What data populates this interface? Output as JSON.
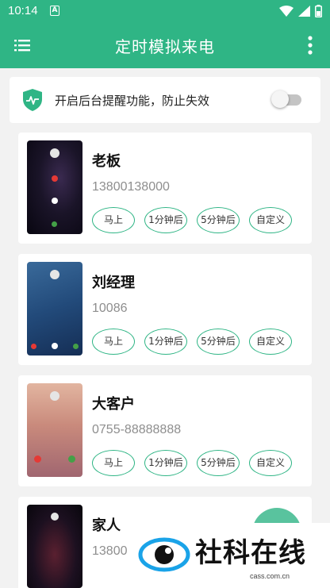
{
  "status_bar": {
    "time": "10:14",
    "notification_icon": "A"
  },
  "app_bar": {
    "title": "定时模拟来电",
    "menu_icon": "menu-icon",
    "more_icon": "more-vert-icon"
  },
  "reminder_toggle": {
    "label": "开启后台提醒功能，防止失效",
    "enabled": false
  },
  "contacts": [
    {
      "name": "老板",
      "number": "13800138000",
      "buttons": [
        "马上",
        "1分钟后",
        "5分钟后",
        "自定义"
      ]
    },
    {
      "name": "刘经理",
      "number": "10086",
      "buttons": [
        "马上",
        "1分钟后",
        "5分钟后",
        "自定义"
      ]
    },
    {
      "name": "大客户",
      "number": "0755-88888888",
      "buttons": [
        "马上",
        "1分钟后",
        "5分钟后",
        "自定义"
      ]
    },
    {
      "name": "家人",
      "number": "13800",
      "buttons": []
    }
  ],
  "watermark": {
    "text": "社科在线",
    "url": "cass.com.cn"
  },
  "colors": {
    "primary": "#2fb585",
    "accent_red": "#e53935",
    "accent_green": "#43a047"
  }
}
